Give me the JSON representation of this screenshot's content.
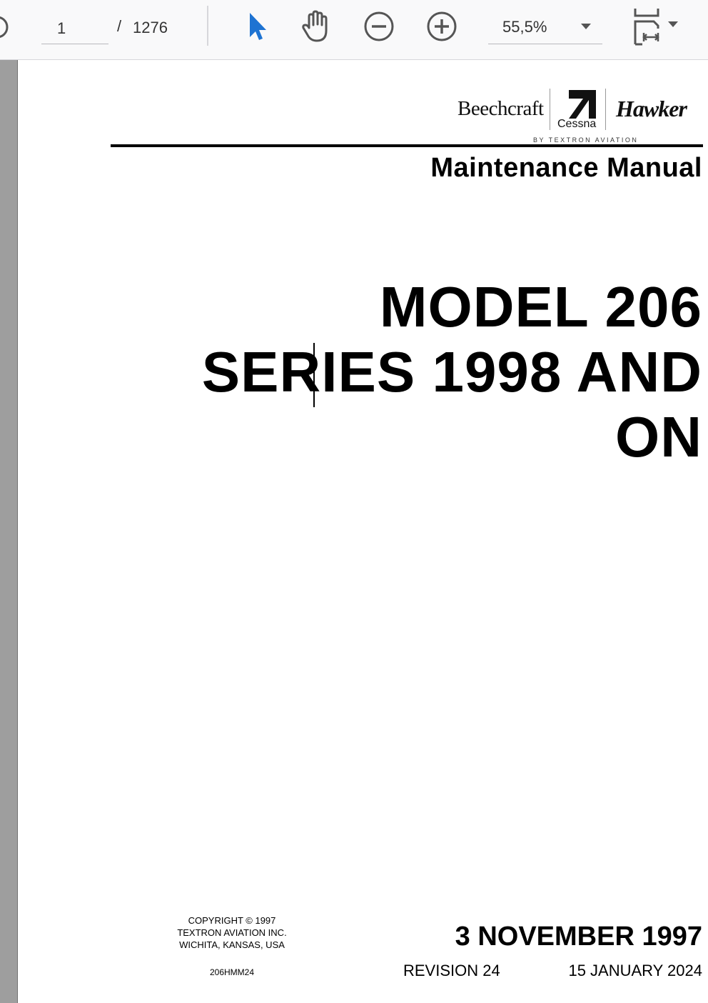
{
  "toolbar": {
    "page_current": "1",
    "page_separator": "/",
    "page_total": "1276",
    "zoom_value": "55,5%",
    "icons": {
      "previous": "previous-page-icon",
      "select": "select-cursor-icon",
      "hand": "hand-tool-icon",
      "zoom_out": "zoom-out-icon",
      "zoom_in": "zoom-in-icon",
      "fit": "fit-page-icon"
    },
    "accent_color": "#1e73d2"
  },
  "document": {
    "logos": {
      "beechcraft": "Beechcraft",
      "cessna": "Cessna",
      "hawker": "Hawker",
      "byline": "BY TEXTRON AVIATION"
    },
    "manual_title": "Maintenance Manual",
    "model_title_lines": [
      "MODEL 206",
      "SERIES 1998 AND",
      "ON"
    ],
    "copyright_lines": [
      "COPYRIGHT © 1997",
      "TEXTRON AVIATION INC.",
      "WICHITA, KANSAS, USA"
    ],
    "document_number": "206HMM24",
    "issue_date": "3 NOVEMBER 1997",
    "revision": "REVISION 24",
    "revision_date": "15 JANUARY 2024"
  }
}
